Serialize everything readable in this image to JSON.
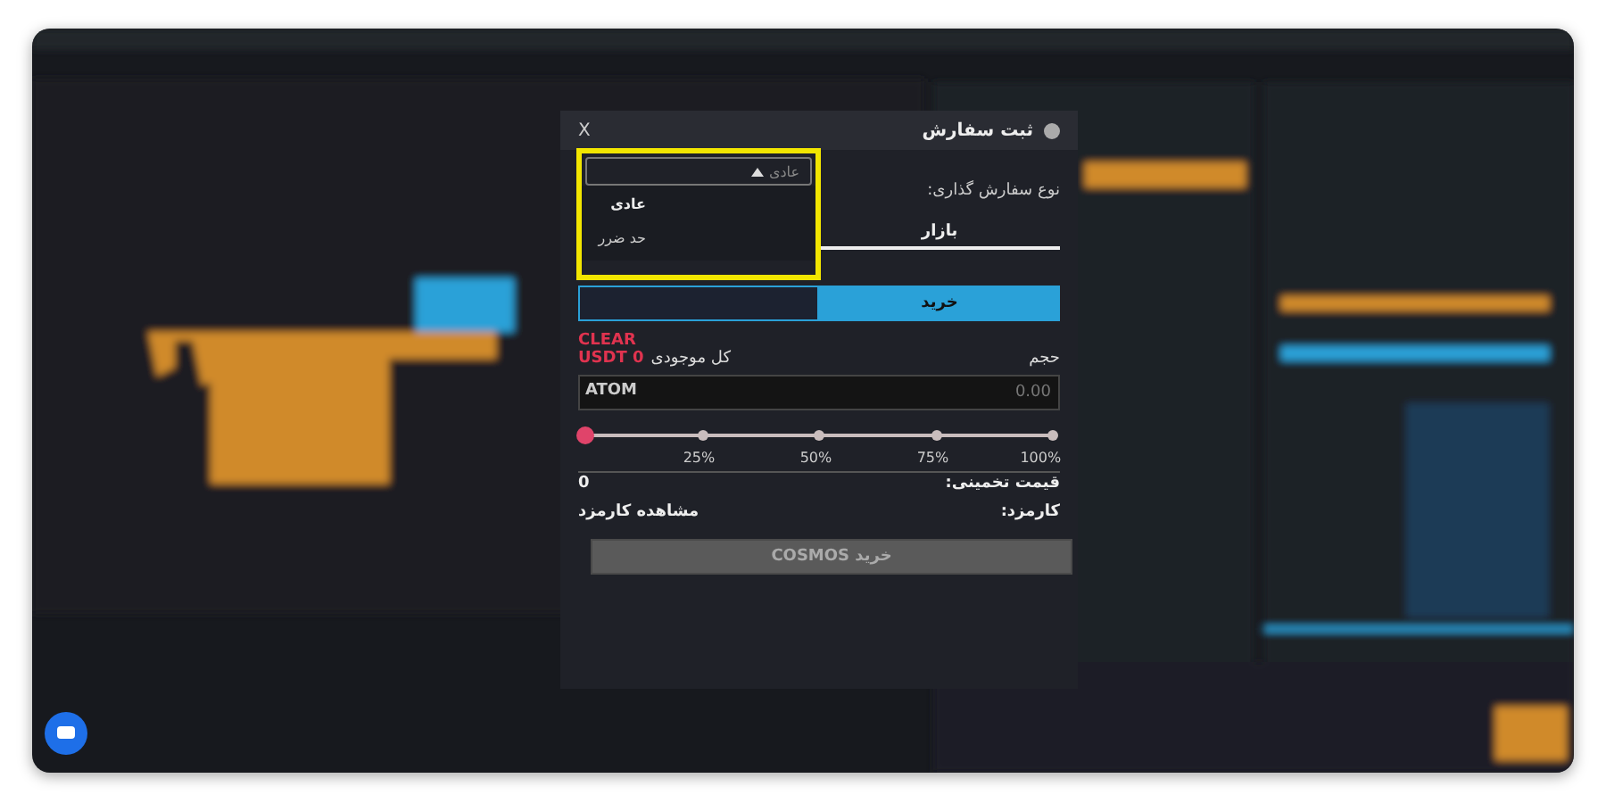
{
  "modal": {
    "title": "ثبت سفارش",
    "close": "X",
    "order_type": {
      "label": "نوع سفارش گذاری:",
      "value": "عادی",
      "expanded": true,
      "options": [
        {
          "label": "عادی",
          "selected": true
        },
        {
          "label": "حد ضرر",
          "selected": false
        }
      ]
    },
    "tabs": [
      {
        "label": "بازار",
        "selected": true
      }
    ],
    "side_buttons": [
      {
        "label": "خرید",
        "selected": true
      }
    ],
    "clear": "CLEAR",
    "volume_label": "حجم",
    "balance_label": "کل موجودی",
    "balance_value": "USDT 0",
    "amount": {
      "placeholder": "0.00",
      "unit": "ATOM"
    },
    "slider": {
      "level": 0,
      "marks": [
        "100%",
        "75%",
        "50%",
        "25%"
      ]
    },
    "estimate_label": "قیمت تخمینی:",
    "estimate_value": "0",
    "fee_label": "کارمزد:",
    "fee_link": "مشاهده کارمزد",
    "submit": {
      "label": "خرید COSMOS",
      "disabled": true
    }
  }
}
